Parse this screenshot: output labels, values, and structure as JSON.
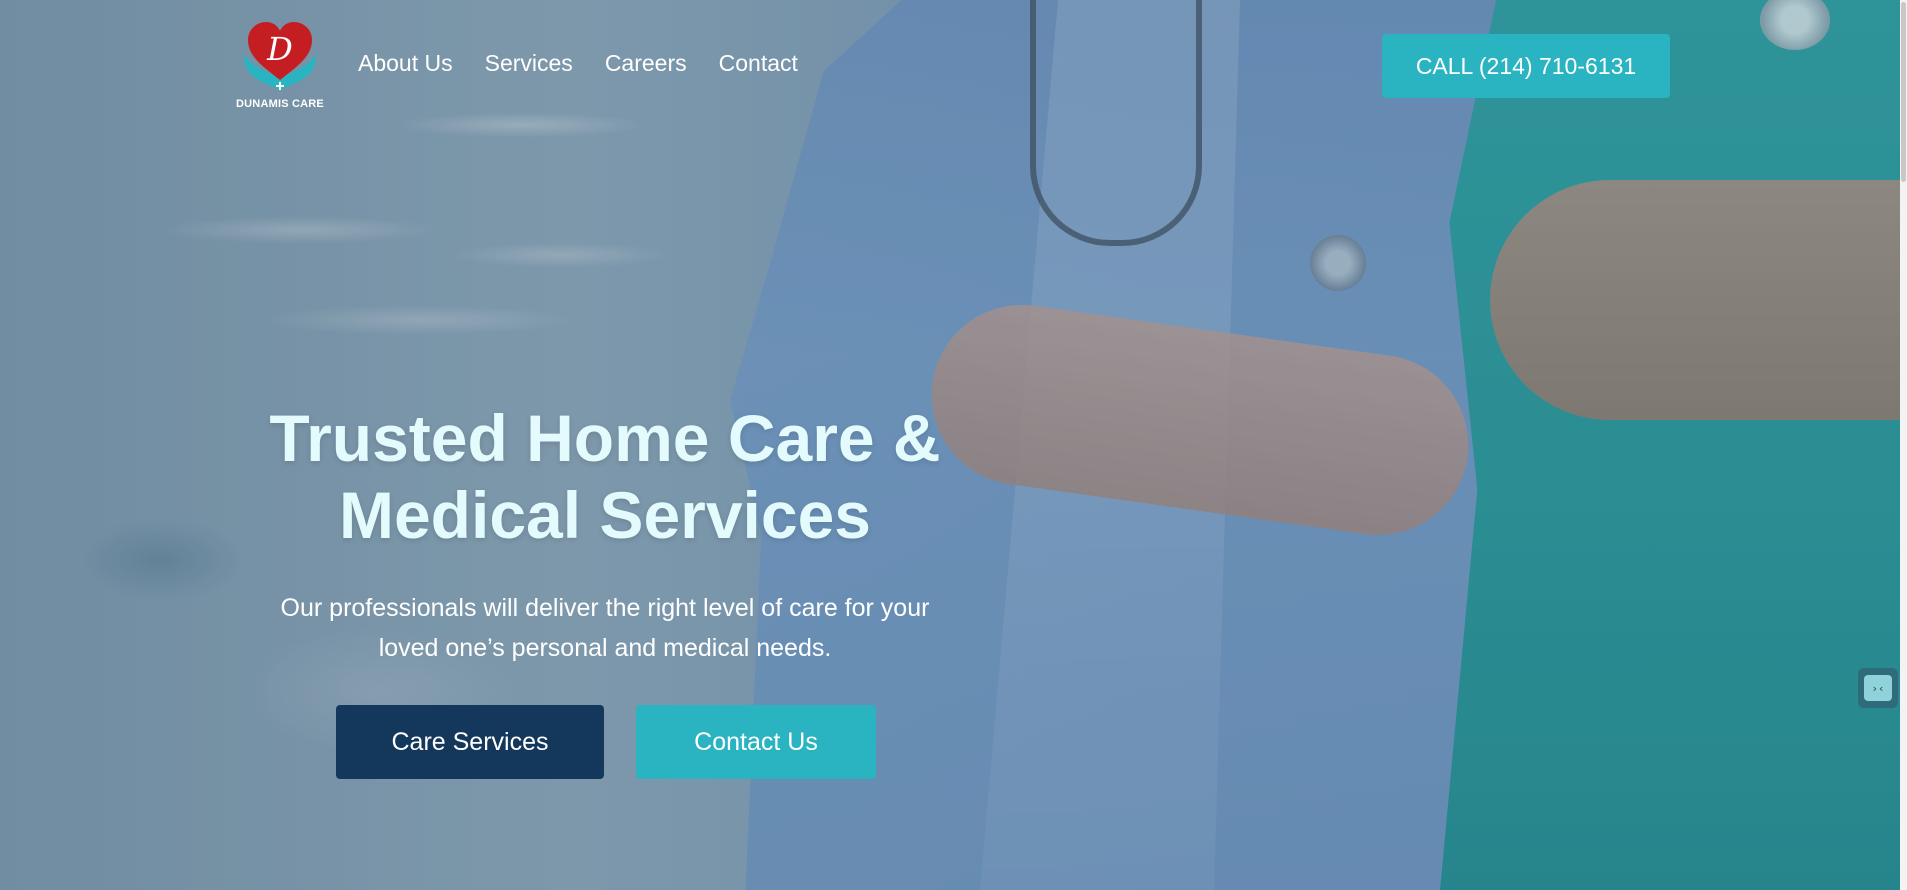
{
  "brand": {
    "logo_text": "DUNAMIS CARE",
    "logo_monogram": "D",
    "colors": {
      "heart": "#c41e22",
      "teal": "#2ab3c0",
      "navy": "#14375c"
    }
  },
  "nav": {
    "items": [
      {
        "label": "About Us"
      },
      {
        "label": "Services"
      },
      {
        "label": "Careers"
      },
      {
        "label": "Contact"
      }
    ]
  },
  "header": {
    "call_label": "CALL (214) 710-6131"
  },
  "hero": {
    "title_line1": "Trusted Home Care &",
    "title_line2": "Medical Services",
    "subtitle_line1": "Our professionals will deliver the right level of care for your",
    "subtitle_line2": "loved one’s personal and medical needs.",
    "primary_button": "Care Services",
    "secondary_button": "Contact Us"
  },
  "widget": {
    "icon": "code-icon",
    "glyph": "›‹"
  }
}
